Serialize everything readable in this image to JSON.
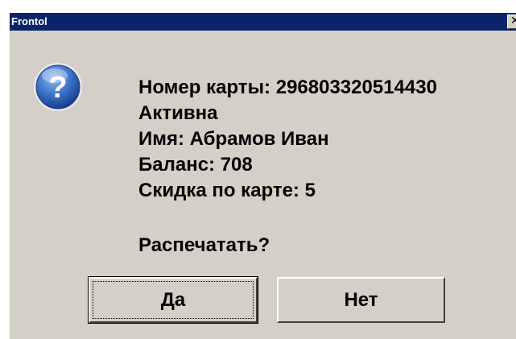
{
  "window": {
    "title": "Frontol",
    "close_symbol": "✕"
  },
  "message": {
    "card_number": "Номер карты: 296803320514430",
    "status": "Активна",
    "name": "Имя: Абрамов Иван",
    "balance": "Баланс: 708",
    "discount": "Скидка по карте: 5",
    "question": "Распечатать?"
  },
  "icon": {
    "name": "question-icon",
    "glyph": "?"
  },
  "buttons": {
    "yes_label": "Да",
    "no_label": "Нет"
  }
}
